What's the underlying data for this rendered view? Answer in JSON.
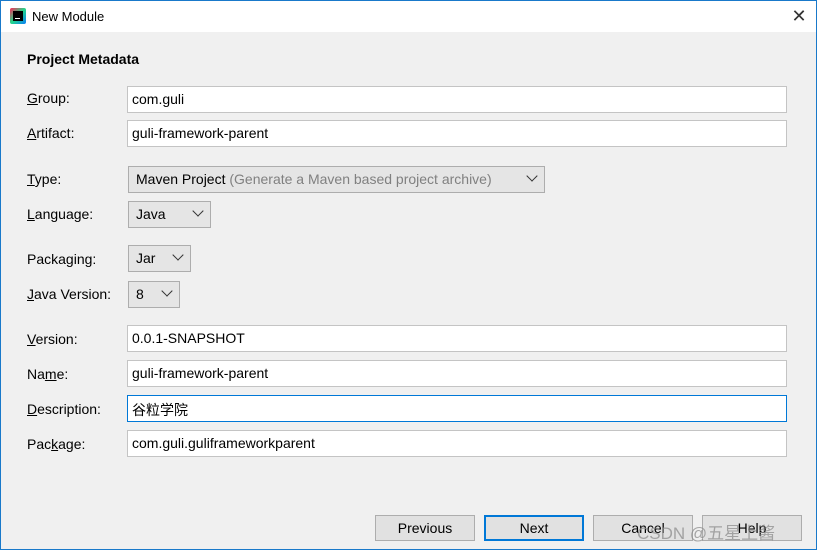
{
  "window": {
    "title": "New Module",
    "close_glyph": "✕"
  },
  "section_title": "Project Metadata",
  "fields": {
    "group": {
      "pre": "",
      "key": "G",
      "post": "roup:",
      "value": "com.guli"
    },
    "artifact": {
      "pre": "",
      "key": "A",
      "post": "rtifact:",
      "value": "guli-framework-parent"
    },
    "type": {
      "pre": "",
      "key": "T",
      "post": "ype:",
      "value": "Maven Project",
      "hint": "(Generate a Maven based project archive)"
    },
    "language": {
      "pre": "",
      "key": "L",
      "post": "anguage:",
      "value": "Java"
    },
    "packaging": {
      "pre": "Packa",
      "key": "g",
      "post": "ing:",
      "value": "Jar"
    },
    "java_version": {
      "pre": "",
      "key": "J",
      "post": "ava Version:",
      "value": "8"
    },
    "version": {
      "pre": "",
      "key": "V",
      "post": "ersion:",
      "value": "0.0.1-SNAPSHOT"
    },
    "name": {
      "pre": "Na",
      "key": "m",
      "post": "e:",
      "value": "guli-framework-parent"
    },
    "description": {
      "pre": "",
      "key": "D",
      "post": "escription:",
      "value": "谷粒学院"
    },
    "package": {
      "pre": "Pac",
      "key": "k",
      "post": "age:",
      "value": "com.guli.guliframeworkparent"
    }
  },
  "buttons": {
    "previous": "Previous",
    "next": "Next",
    "cancel": "Cancel",
    "help": "Help"
  },
  "watermark": "CSDN @五星上酱"
}
